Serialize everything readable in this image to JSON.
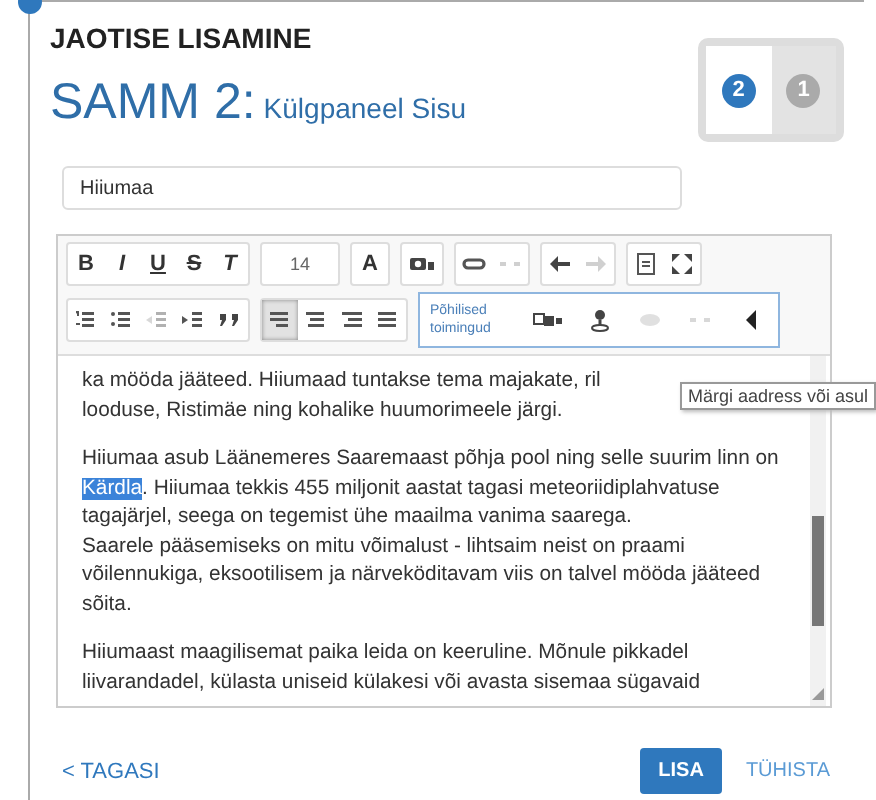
{
  "header": {
    "kicker": "JAOTISE LISAMINE",
    "step_label": "SAMM 2:",
    "step_name": "Külgpaneel Sisu"
  },
  "steps": [
    {
      "number": "2",
      "selected": true
    },
    {
      "number": "1",
      "selected": false
    }
  ],
  "title_field": {
    "value": "Hiiumaa"
  },
  "toolbar": {
    "rows": [
      [
        {
          "items": [
            {
              "label": "B",
              "disabled": false,
              "selected": false
            },
            {
              "label": "I",
              "disabled": false,
              "selected": false
            },
            {
              "label": "U",
              "disabled": false,
              "selected": false
            },
            {
              "label": "S",
              "disabled": false,
              "selected": false
            },
            {
              "label": "T",
              "disabled": false,
              "selected": false
            }
          ]
        },
        {
          "items": [
            {
              "label": "14",
              "disabled": false,
              "selected": false
            }
          ]
        },
        {
          "items": [
            {
              "label": "A",
              "disabled": false,
              "selected": false
            }
          ]
        },
        {
          "items": [
            {
              "disabled": false,
              "selected": false
            }
          ]
        },
        {
          "items": [
            {
              "disabled": false,
              "selected": false
            },
            {
              "disabled": true,
              "selected": false
            }
          ]
        },
        {
          "items": [
            {
              "disabled": false,
              "selected": false
            },
            {
              "disabled": true,
              "selected": false
            }
          ]
        },
        {
          "items": [
            {
              "disabled": false,
              "selected": false
            },
            {
              "disabled": false,
              "selected": false
            }
          ]
        }
      ],
      [
        {
          "items": [
            {
              "disabled": false,
              "selected": false
            },
            {
              "disabled": false,
              "selected": false
            },
            {
              "disabled": true,
              "selected": false
            },
            {
              "disabled": false,
              "selected": false
            },
            {
              "disabled": false,
              "selected": false
            }
          ]
        },
        {
          "items": [
            {
              "disabled": false,
              "selected": true
            },
            {
              "disabled": false,
              "selected": false
            },
            {
              "disabled": false,
              "selected": false
            },
            {
              "disabled": false,
              "selected": false
            }
          ]
        }
      ]
    ],
    "custom_group": {
      "label": "Põhilised toimingud",
      "items": [
        {
          "disabled": false
        },
        {
          "disabled": false
        },
        {
          "disabled": true
        },
        {
          "disabled": true
        },
        {
          "disabled": false
        }
      ]
    }
  },
  "content": {
    "paragraphs": [
      [
        [
          {
            "text": "ka mööda jääteed. Hiiumaad tuntakse tema majakate, ril",
            "selected": false
          }
        ],
        [
          {
            "text": "looduse, Ristimäe ning kohalike huumorimeele järgi.",
            "selected": false
          }
        ]
      ],
      [
        [
          {
            "text": "Hiiumaa asub Läänemeres Saaremaast põhja pool ning selle suurim linn on",
            "selected": false
          }
        ],
        [
          {
            "text": "Kärdla",
            "selected": true
          },
          {
            "text": ". Hiiumaa tekkis 455 miljonit aastat tagasi meteoriidiplahvatuse",
            "selected": false
          }
        ],
        [
          {
            "text": "tagajärjel, seega on tegemist ühe maailma vanima saarega.",
            "selected": false
          }
        ],
        [
          {
            "text": "Saarele pääsemiseks on mitu võimalust - lihtsaim neist on praami",
            "selected": false
          }
        ],
        [
          {
            "text": "võilennukiga, eksootilisem ja närveköditavam viis on talvel mööda jääteed",
            "selected": false
          }
        ],
        [
          {
            "text": "sõita.",
            "selected": false
          }
        ]
      ],
      [
        [
          {
            "text": "Hiiumaast maagilisemat paika leida on keeruline. Mõnule pikkadel",
            "selected": false
          }
        ],
        [
          {
            "text": "liivarandadel, külasta uniseid külakesi või avasta sisemaa sügavaid",
            "selected": false
          }
        ]
      ]
    ]
  },
  "tooltip": {
    "text": "Märgi aadress või asul"
  },
  "footer": {
    "back": "< TAGASI",
    "primary": "LISA",
    "cancel": "TÜHISTA"
  }
}
